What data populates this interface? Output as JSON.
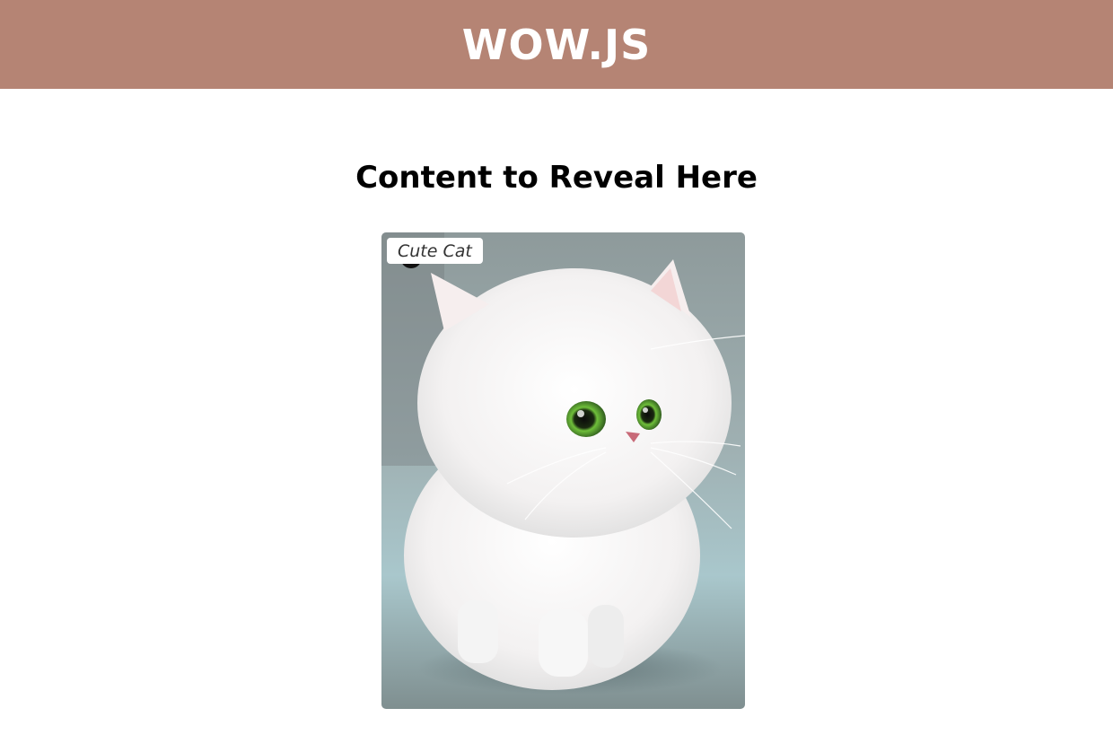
{
  "header": {
    "title": "WOW.JS",
    "background_color": "#b58474"
  },
  "main": {
    "heading": "Content to Reveal Here",
    "card": {
      "caption": "Cute Cat",
      "image_subject": "fluffy white kitten with green eyes"
    }
  }
}
